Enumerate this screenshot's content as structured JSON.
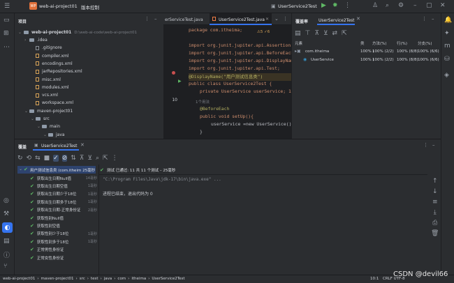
{
  "titlebar": {
    "logo": "WP",
    "project": "web-ai-project01",
    "vcs": "版本控制",
    "run_config": "UserService2Test"
  },
  "project_panel": {
    "title": "项目",
    "root": "web-ai-project01",
    "root_path": "D:\\web-ai-code\\web-ai-project01",
    "items": [
      {
        "label": ".idea",
        "kind": "folder"
      },
      {
        "label": ".gitignore",
        "kind": "file"
      },
      {
        "label": "compiler.xml",
        "kind": "xml"
      },
      {
        "label": "encodings.xml",
        "kind": "xml"
      },
      {
        "label": "jarRepositories.xml",
        "kind": "xml"
      },
      {
        "label": "misc.xml",
        "kind": "xml"
      },
      {
        "label": "modules.xml",
        "kind": "xml"
      },
      {
        "label": "vcs.xml",
        "kind": "xml"
      },
      {
        "label": "workspace.xml",
        "kind": "xml"
      },
      {
        "label": "maven-project01",
        "kind": "folder"
      },
      {
        "label": "src",
        "kind": "folder"
      },
      {
        "label": "main",
        "kind": "folder"
      },
      {
        "label": "java",
        "kind": "folder"
      }
    ]
  },
  "editor": {
    "tabs": [
      "erServiceTest.java",
      "UserService2Test.java"
    ],
    "inspection": "⚠5 ✓6",
    "lines": [
      {
        "n": "",
        "t": "package com.itheima;"
      },
      {
        "n": "",
        "t": "import org.junit.jupiter.api.Assertions"
      },
      {
        "n": "",
        "t": "import org.junit.jupiter.api.BeforeEach"
      },
      {
        "n": "",
        "t": "import org.junit.jupiter.api.DisplayName"
      },
      {
        "n": "",
        "t": "import org.junit.jupiter.api.Test;"
      },
      {
        "n": "",
        "t": "@DisplayName(\"用户测试信息类\")"
      },
      {
        "n": "",
        "t": "public class UserService2Test {"
      },
      {
        "n": "",
        "t": "private UserService userService;  12"
      },
      {
        "n": "10",
        "t": ""
      },
      {
        "n": "",
        "t": "@BeforeEach"
      },
      {
        "n": "",
        "t": "public void setUp(){"
      },
      {
        "n": "",
        "t": "userService =new UserService();"
      },
      {
        "n": "",
        "t": "}"
      }
    ],
    "usage_hint": "1个用法"
  },
  "coverage": {
    "title": "覆盖率",
    "tab": "UserService2Test",
    "headers": [
      "元素",
      "类",
      "方法(%)",
      "行(%)",
      "分支(%)"
    ],
    "rows": [
      {
        "name": "com.itheima",
        "cls": "100% (",
        "method": "100% (2/2)",
        "line": "100% (8/8)",
        "branch": "100% (6/6)"
      },
      {
        "name": "UserService",
        "cls": "100% (",
        "method": "100% (2/2)",
        "line": "100% (8/8)",
        "branch": "100% (6/6)"
      }
    ]
  },
  "run": {
    "title": "覆盖",
    "tab": "UserService2Test",
    "root_test": "用户测试信息类 (com.itheim 25毫秒",
    "tests": [
      {
        "name": "获取出生日期Null值",
        "time": "14毫秒"
      },
      {
        "name": "获取出生日期空值",
        "time": "1毫秒"
      },
      {
        "name": "获取出生日期少于18位",
        "time": "1毫秒"
      },
      {
        "name": "获取出生日期多于18位",
        "time": "1毫秒"
      },
      {
        "name": "获取出生日期-正常身份证",
        "time": "2毫秒"
      },
      {
        "name": "获取性别Null值",
        "time": ""
      },
      {
        "name": "获取性别空值",
        "time": ""
      },
      {
        "name": "获取性别少于18位",
        "time": "1毫秒"
      },
      {
        "name": "获取性别多于18位",
        "time": "1毫秒"
      },
      {
        "name": "正常男性身份证",
        "time": ""
      },
      {
        "name": "正常女性身份证",
        "time": ""
      }
    ],
    "summary": "测试 已通过: 11 共 11 个测试 – 25毫秒",
    "console": [
      "\"C:\\Program Files\\Java\\jdk-17\\bin\\java.exe\" ...",
      "进程已结束，退出代码为 0"
    ]
  },
  "status": {
    "breadcrumbs": [
      "web-ai-project01",
      "maven-project01",
      "src",
      "test",
      "java",
      "com",
      "itheima",
      "UserService2Test"
    ],
    "position": "10:1",
    "encoding": "CRLF  UTF-8",
    "watermark": "CSDN @devil66"
  }
}
